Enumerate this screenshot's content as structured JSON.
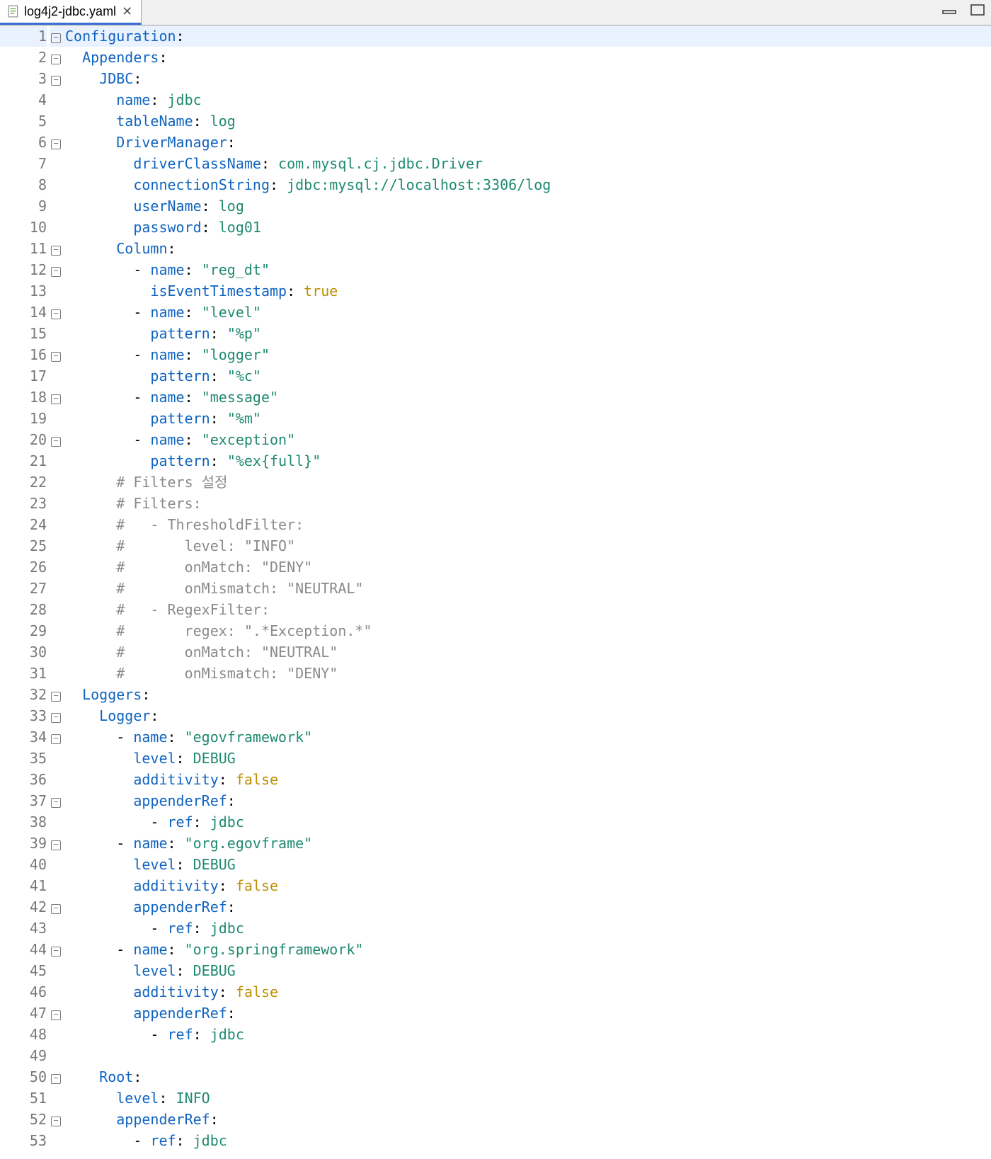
{
  "tab": {
    "filename": "log4j2-jdbc.yaml"
  },
  "lines": [
    {
      "n": 1,
      "fold": true,
      "hl": true,
      "seg": [
        [
          "k",
          "Configuration"
        ],
        [
          "p",
          ":"
        ]
      ]
    },
    {
      "n": 2,
      "fold": true,
      "seg": [
        [
          "p",
          "  "
        ],
        [
          "k",
          "Appenders"
        ],
        [
          "p",
          ":"
        ]
      ]
    },
    {
      "n": 3,
      "fold": true,
      "seg": [
        [
          "p",
          "    "
        ],
        [
          "k",
          "JDBC"
        ],
        [
          "p",
          ":"
        ]
      ]
    },
    {
      "n": 4,
      "seg": [
        [
          "p",
          "      "
        ],
        [
          "k",
          "name"
        ],
        [
          "p",
          ": "
        ],
        [
          "s",
          "jdbc"
        ]
      ]
    },
    {
      "n": 5,
      "seg": [
        [
          "p",
          "      "
        ],
        [
          "k",
          "tableName"
        ],
        [
          "p",
          ": "
        ],
        [
          "s",
          "log"
        ]
      ]
    },
    {
      "n": 6,
      "fold": true,
      "seg": [
        [
          "p",
          "      "
        ],
        [
          "k",
          "DriverManager"
        ],
        [
          "p",
          ":"
        ]
      ]
    },
    {
      "n": 7,
      "seg": [
        [
          "p",
          "        "
        ],
        [
          "k",
          "driverClassName"
        ],
        [
          "p",
          ": "
        ],
        [
          "s",
          "com.mysql.cj.jdbc.Driver"
        ]
      ]
    },
    {
      "n": 8,
      "seg": [
        [
          "p",
          "        "
        ],
        [
          "k",
          "connectionString"
        ],
        [
          "p",
          ": "
        ],
        [
          "s",
          "jdbc:mysql://localhost:3306/log"
        ]
      ]
    },
    {
      "n": 9,
      "seg": [
        [
          "p",
          "        "
        ],
        [
          "k",
          "userName"
        ],
        [
          "p",
          ": "
        ],
        [
          "s",
          "log"
        ]
      ]
    },
    {
      "n": 10,
      "seg": [
        [
          "p",
          "        "
        ],
        [
          "k",
          "password"
        ],
        [
          "p",
          ": "
        ],
        [
          "s",
          "log01"
        ]
      ]
    },
    {
      "n": 11,
      "fold": true,
      "seg": [
        [
          "p",
          "      "
        ],
        [
          "k",
          "Column"
        ],
        [
          "p",
          ":"
        ]
      ]
    },
    {
      "n": 12,
      "fold": true,
      "seg": [
        [
          "p",
          "        - "
        ],
        [
          "k",
          "name"
        ],
        [
          "p",
          ": "
        ],
        [
          "s",
          "\"reg_dt\""
        ]
      ]
    },
    {
      "n": 13,
      "seg": [
        [
          "p",
          "          "
        ],
        [
          "k",
          "isEventTimestamp"
        ],
        [
          "p",
          ": "
        ],
        [
          "b",
          "true"
        ]
      ]
    },
    {
      "n": 14,
      "fold": true,
      "seg": [
        [
          "p",
          "        - "
        ],
        [
          "k",
          "name"
        ],
        [
          "p",
          ": "
        ],
        [
          "s",
          "\"level\""
        ]
      ]
    },
    {
      "n": 15,
      "seg": [
        [
          "p",
          "          "
        ],
        [
          "k",
          "pattern"
        ],
        [
          "p",
          ": "
        ],
        [
          "s",
          "\"%p\""
        ]
      ]
    },
    {
      "n": 16,
      "fold": true,
      "seg": [
        [
          "p",
          "        - "
        ],
        [
          "k",
          "name"
        ],
        [
          "p",
          ": "
        ],
        [
          "s",
          "\"logger\""
        ]
      ]
    },
    {
      "n": 17,
      "seg": [
        [
          "p",
          "          "
        ],
        [
          "k",
          "pattern"
        ],
        [
          "p",
          ": "
        ],
        [
          "s",
          "\"%c\""
        ]
      ]
    },
    {
      "n": 18,
      "fold": true,
      "seg": [
        [
          "p",
          "        - "
        ],
        [
          "k",
          "name"
        ],
        [
          "p",
          ": "
        ],
        [
          "s",
          "\"message\""
        ]
      ]
    },
    {
      "n": 19,
      "seg": [
        [
          "p",
          "          "
        ],
        [
          "k",
          "pattern"
        ],
        [
          "p",
          ": "
        ],
        [
          "s",
          "\"%m\""
        ]
      ]
    },
    {
      "n": 20,
      "fold": true,
      "seg": [
        [
          "p",
          "        - "
        ],
        [
          "k",
          "name"
        ],
        [
          "p",
          ": "
        ],
        [
          "s",
          "\"exception\""
        ]
      ]
    },
    {
      "n": 21,
      "seg": [
        [
          "p",
          "          "
        ],
        [
          "k",
          "pattern"
        ],
        [
          "p",
          ": "
        ],
        [
          "s",
          "\"%ex{full}\""
        ]
      ]
    },
    {
      "n": 22,
      "seg": [
        [
          "p",
          "      "
        ],
        [
          "c",
          "# Filters 설정"
        ]
      ]
    },
    {
      "n": 23,
      "seg": [
        [
          "p",
          "      "
        ],
        [
          "c",
          "# Filters:"
        ]
      ]
    },
    {
      "n": 24,
      "seg": [
        [
          "p",
          "      "
        ],
        [
          "c",
          "#   - ThresholdFilter:"
        ]
      ]
    },
    {
      "n": 25,
      "seg": [
        [
          "p",
          "      "
        ],
        [
          "c",
          "#       level: \"INFO\""
        ]
      ]
    },
    {
      "n": 26,
      "seg": [
        [
          "p",
          "      "
        ],
        [
          "c",
          "#       onMatch: \"DENY\""
        ]
      ]
    },
    {
      "n": 27,
      "seg": [
        [
          "p",
          "      "
        ],
        [
          "c",
          "#       onMismatch: \"NEUTRAL\""
        ]
      ]
    },
    {
      "n": 28,
      "seg": [
        [
          "p",
          "      "
        ],
        [
          "c",
          "#   - RegexFilter:"
        ]
      ]
    },
    {
      "n": 29,
      "seg": [
        [
          "p",
          "      "
        ],
        [
          "c",
          "#       regex: \".*Exception.*\""
        ]
      ]
    },
    {
      "n": 30,
      "seg": [
        [
          "p",
          "      "
        ],
        [
          "c",
          "#       onMatch: \"NEUTRAL\""
        ]
      ]
    },
    {
      "n": 31,
      "seg": [
        [
          "p",
          "      "
        ],
        [
          "c",
          "#       onMismatch: \"DENY\""
        ]
      ]
    },
    {
      "n": 32,
      "fold": true,
      "seg": [
        [
          "p",
          "  "
        ],
        [
          "k",
          "Loggers"
        ],
        [
          "p",
          ":"
        ]
      ]
    },
    {
      "n": 33,
      "fold": true,
      "seg": [
        [
          "p",
          "    "
        ],
        [
          "k",
          "Logger"
        ],
        [
          "p",
          ":"
        ]
      ]
    },
    {
      "n": 34,
      "fold": true,
      "seg": [
        [
          "p",
          "      - "
        ],
        [
          "k",
          "name"
        ],
        [
          "p",
          ": "
        ],
        [
          "s",
          "\"egovframework\""
        ]
      ]
    },
    {
      "n": 35,
      "seg": [
        [
          "p",
          "        "
        ],
        [
          "k",
          "level"
        ],
        [
          "p",
          ": "
        ],
        [
          "s",
          "DEBUG"
        ]
      ]
    },
    {
      "n": 36,
      "seg": [
        [
          "p",
          "        "
        ],
        [
          "k",
          "additivity"
        ],
        [
          "p",
          ": "
        ],
        [
          "b",
          "false"
        ]
      ]
    },
    {
      "n": 37,
      "fold": true,
      "seg": [
        [
          "p",
          "        "
        ],
        [
          "k",
          "appenderRef"
        ],
        [
          "p",
          ":"
        ]
      ]
    },
    {
      "n": 38,
      "seg": [
        [
          "p",
          "          - "
        ],
        [
          "k",
          "ref"
        ],
        [
          "p",
          ": "
        ],
        [
          "s",
          "jdbc"
        ]
      ]
    },
    {
      "n": 39,
      "fold": true,
      "seg": [
        [
          "p",
          "      - "
        ],
        [
          "k",
          "name"
        ],
        [
          "p",
          ": "
        ],
        [
          "s",
          "\"org.egovframe\""
        ]
      ]
    },
    {
      "n": 40,
      "seg": [
        [
          "p",
          "        "
        ],
        [
          "k",
          "level"
        ],
        [
          "p",
          ": "
        ],
        [
          "s",
          "DEBUG"
        ]
      ]
    },
    {
      "n": 41,
      "seg": [
        [
          "p",
          "        "
        ],
        [
          "k",
          "additivity"
        ],
        [
          "p",
          ": "
        ],
        [
          "b",
          "false"
        ]
      ]
    },
    {
      "n": 42,
      "fold": true,
      "seg": [
        [
          "p",
          "        "
        ],
        [
          "k",
          "appenderRef"
        ],
        [
          "p",
          ":"
        ]
      ]
    },
    {
      "n": 43,
      "seg": [
        [
          "p",
          "          - "
        ],
        [
          "k",
          "ref"
        ],
        [
          "p",
          ": "
        ],
        [
          "s",
          "jdbc"
        ]
      ]
    },
    {
      "n": 44,
      "fold": true,
      "seg": [
        [
          "p",
          "      - "
        ],
        [
          "k",
          "name"
        ],
        [
          "p",
          ": "
        ],
        [
          "s",
          "\"org.springframework\""
        ]
      ]
    },
    {
      "n": 45,
      "seg": [
        [
          "p",
          "        "
        ],
        [
          "k",
          "level"
        ],
        [
          "p",
          ": "
        ],
        [
          "s",
          "DEBUG"
        ]
      ]
    },
    {
      "n": 46,
      "seg": [
        [
          "p",
          "        "
        ],
        [
          "k",
          "additivity"
        ],
        [
          "p",
          ": "
        ],
        [
          "b",
          "false"
        ]
      ]
    },
    {
      "n": 47,
      "fold": true,
      "seg": [
        [
          "p",
          "        "
        ],
        [
          "k",
          "appenderRef"
        ],
        [
          "p",
          ":"
        ]
      ]
    },
    {
      "n": 48,
      "seg": [
        [
          "p",
          "          - "
        ],
        [
          "k",
          "ref"
        ],
        [
          "p",
          ": "
        ],
        [
          "s",
          "jdbc"
        ]
      ]
    },
    {
      "n": 49,
      "seg": [
        [
          "p",
          ""
        ]
      ]
    },
    {
      "n": 50,
      "fold": true,
      "seg": [
        [
          "p",
          "    "
        ],
        [
          "k",
          "Root"
        ],
        [
          "p",
          ":"
        ]
      ]
    },
    {
      "n": 51,
      "seg": [
        [
          "p",
          "      "
        ],
        [
          "k",
          "level"
        ],
        [
          "p",
          ": "
        ],
        [
          "s",
          "INFO"
        ]
      ]
    },
    {
      "n": 52,
      "fold": true,
      "seg": [
        [
          "p",
          "      "
        ],
        [
          "k",
          "appenderRef"
        ],
        [
          "p",
          ":"
        ]
      ]
    },
    {
      "n": 53,
      "seg": [
        [
          "p",
          "        - "
        ],
        [
          "k",
          "ref"
        ],
        [
          "p",
          ": "
        ],
        [
          "s",
          "jdbc"
        ]
      ]
    }
  ]
}
